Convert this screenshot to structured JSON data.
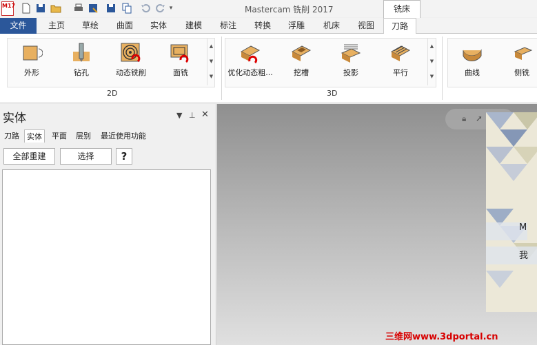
{
  "app": {
    "logo_text": "M17",
    "title": "Mastercam 铣削 2017",
    "context_tab": "铣床"
  },
  "qat_icons": [
    "new-icon",
    "save-icon",
    "open-icon",
    "print-icon",
    "save-as-icon",
    "save-file-icon",
    "copy-icon",
    "undo-icon",
    "redo-icon",
    "customize-icon"
  ],
  "tabs": [
    {
      "label": "文件"
    },
    {
      "label": "主页"
    },
    {
      "label": "草绘"
    },
    {
      "label": "曲面"
    },
    {
      "label": "实体"
    },
    {
      "label": "建模"
    },
    {
      "label": "标注"
    },
    {
      "label": "转换"
    },
    {
      "label": "浮雕"
    },
    {
      "label": "机床"
    },
    {
      "label": "视图"
    },
    {
      "label": "刀路"
    }
  ],
  "ribbon": {
    "group_2d": {
      "label": "2D",
      "buttons": [
        {
          "label": "外形",
          "icon": "contour-icon"
        },
        {
          "label": "钻孔",
          "icon": "drill-icon"
        },
        {
          "label": "动态铣削",
          "icon": "dynamic-mill-icon"
        },
        {
          "label": "面铣",
          "icon": "face-mill-icon"
        }
      ]
    },
    "group_3d": {
      "label": "3D",
      "buttons": [
        {
          "label": "优化动态粗...",
          "icon": "optirough-icon"
        },
        {
          "label": "挖槽",
          "icon": "pocket-icon"
        },
        {
          "label": "投影",
          "icon": "project-icon"
        },
        {
          "label": "平行",
          "icon": "parallel-icon"
        }
      ]
    },
    "group_multi": {
      "buttons": [
        {
          "label": "曲线",
          "icon": "curve-icon"
        },
        {
          "label": "侧铣",
          "icon": "swarf-icon"
        }
      ]
    }
  },
  "panel": {
    "title": "实体",
    "tabs": [
      "刀路",
      "实体",
      "平面",
      "层别",
      "最近使用功能"
    ],
    "buttons": {
      "rebuild": "全部重建",
      "select": "选择",
      "help": "?"
    }
  },
  "overlay_chat": {
    "line1": "M",
    "line2": "我"
  },
  "watermark": "三维网www.3dportal.cn",
  "colors": {
    "file_tab": "#2b579a",
    "accent_red": "#d80000"
  }
}
